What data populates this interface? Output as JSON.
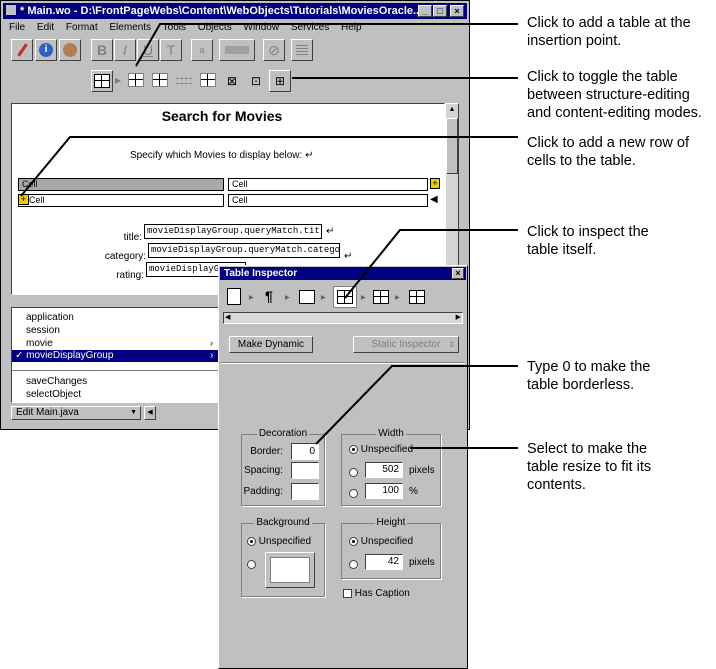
{
  "main_window": {
    "title": "* Main.wo - D:\\FrontPageWebs\\Content\\WebObjects\\Tutorials\\MoviesOracle...",
    "menu": [
      "File",
      "Edit",
      "Format",
      "Elements",
      "Tools",
      "Objects",
      "Window",
      "Services",
      "Help"
    ],
    "page_heading": "Search for Movies",
    "instruction": "Specify which Movies to display below:",
    "table_cells": [
      "Cell",
      "Cell",
      "Cell",
      "Cell"
    ],
    "form": {
      "title_label": "title:",
      "title_value": "movieDisplayGroup.queryMatch.title",
      "category_label": "category:",
      "category_value": "movieDisplayGroup.queryMatch.category",
      "rating_label": "rating:",
      "rating_value": "movieDisplayGroup.queryMatch.rating"
    },
    "object_list": [
      "application",
      "session",
      "movie",
      "movieDisplayGroup",
      "",
      "saveChanges",
      "selectObject"
    ],
    "selected_object": "movieDisplayGroup",
    "status_popup": "Edit Main.java"
  },
  "inspector": {
    "title": "Table Inspector",
    "make_dynamic_label": "Make Dynamic",
    "static_inspector_label": "Static Inspector",
    "decoration": {
      "group_title": "Decoration",
      "border_label": "Border:",
      "border_value": "0",
      "spacing_label": "Spacing:",
      "spacing_value": "",
      "padding_label": "Padding:",
      "padding_value": ""
    },
    "width": {
      "group_title": "Width",
      "unspecified_label": "Unspecified",
      "pixels_value": "502",
      "pixels_label": "pixels",
      "percent_value": "100",
      "percent_label": "%",
      "selected": "Unspecified"
    },
    "background": {
      "group_title": "Background",
      "unspecified_label": "Unspecified",
      "swatch_color": "#ffffff"
    },
    "height": {
      "group_title": "Height",
      "unspecified_label": "Unspecified",
      "pixels_value": "42",
      "pixels_label": "pixels"
    },
    "has_caption_label": "Has Caption"
  },
  "annotations": [
    {
      "text": "Click to add a table at the insertion point."
    },
    {
      "text": "Click to toggle the table between structure-editing and content-editing modes."
    },
    {
      "text": "Click to add a new row of cells to the table."
    },
    {
      "text": "Click to inspect the table itself."
    },
    {
      "text": "Type 0 to make the table borderless."
    },
    {
      "text": "Select to make the table resize to fit its contents."
    }
  ],
  "colors": {
    "titlebar": "#000080",
    "window_face": "#c0c0c0",
    "selection": "#000080"
  }
}
